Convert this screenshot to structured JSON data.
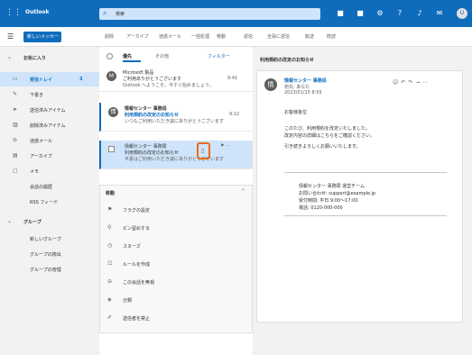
{
  "topbar": {
    "app_name": "Outlook",
    "search_text": "検索",
    "icons": [
      "meet-icon",
      "chat-icon",
      "settings-icon",
      "help-icon",
      "bell-icon",
      "feedback-icon"
    ],
    "avatar_initial": "U"
  },
  "ribbon": {
    "new_mail": "新しいメッセージ",
    "buttons": [
      "削除",
      "アーカイブ",
      "迷惑メール",
      "一括処理",
      "移動",
      "返信",
      "全員に返信",
      "転送",
      "既読"
    ]
  },
  "folders": [
    {
      "label": "お気に入り",
      "group": true
    },
    {
      "label": "受信トレイ",
      "count": "3",
      "selected": true
    },
    {
      "label": "下書き"
    },
    {
      "label": "送信済みアイテム"
    },
    {
      "label": "削除済みアイテム"
    },
    {
      "label": "迷惑メール"
    },
    {
      "label": "アーカイブ"
    },
    {
      "label": "メモ"
    },
    {
      "label": "会話の履歴"
    },
    {
      "label": "RSS フィード"
    },
    {
      "label": "グループ",
      "group": true
    },
    {
      "label": "新しいグループ"
    },
    {
      "label": "グループの検出"
    },
    {
      "label": "グループの管理"
    }
  ],
  "list": {
    "tab_focused": "優先",
    "tab_other": "その他",
    "filter": "フィルター",
    "messages": [
      {
        "sender": "Microsoft 製品",
        "subject": "ご利用ありがとうございます",
        "preview": "Outlook へようこそ。今すぐ始めましょう。",
        "time": "9:41",
        "state": "read"
      },
      {
        "sender": "情報センター 事務局",
        "subject": "利用規約の改定のお知らせ",
        "preview": "いつもご利用いただき誠にありがとうございます",
        "time": "9:12",
        "state": "unread"
      },
      {
        "sender": "情報センター 事務局",
        "subject": "利用規約の改定のお知らせ",
        "preview": "平素はご利用いただき誠にありがとうございます",
        "time": "8:55",
        "state": "selected"
      }
    ]
  },
  "context_menu": {
    "title": "移動",
    "items": [
      {
        "icon": "flag-icon",
        "label": "フラグの設定"
      },
      {
        "icon": "pin-icon",
        "label": "ピン留めする"
      },
      {
        "icon": "snooze-icon",
        "label": "スヌーズ"
      },
      {
        "icon": "rule-icon",
        "label": "ルールを作成"
      },
      {
        "icon": "mute-icon",
        "label": "この会話を無視"
      },
      {
        "icon": "category-icon",
        "label": "分類"
      },
      {
        "icon": "block-icon",
        "label": "送信者を禁止"
      }
    ]
  },
  "reading": {
    "subject": "利用規約の改定のお知らせ",
    "sender": "情報センター 事務局",
    "to": "宛先: あなた",
    "date": "2023/01/15 8:55",
    "body": [
      "お客様各位",
      "このたび、利用規約を改定いたしました。",
      "改定内容の詳細はこちらをご確認ください。",
      "引き続きよろしくお願いいたします。"
    ],
    "signature": [
      "情報センター 事務局 運営チーム",
      "お問い合わせ: support@example.jp",
      "受付時間: 平日 9:00〜17:00",
      "電話: 0120-000-000"
    ]
  }
}
